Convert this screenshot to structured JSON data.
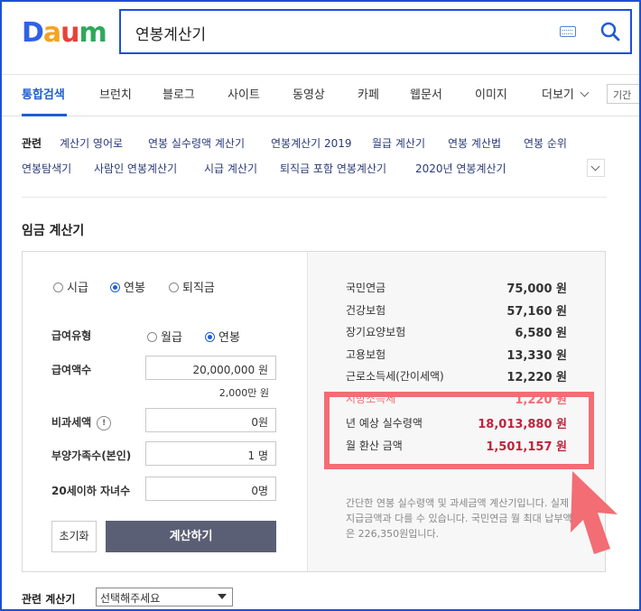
{
  "logo": {
    "text": "Daum",
    "letters": [
      "D",
      "a",
      "u",
      "m"
    ]
  },
  "search": {
    "query": "연봉계산기"
  },
  "tabs": [
    {
      "label": "통합검색",
      "active": true
    },
    {
      "label": "브런치"
    },
    {
      "label": "블로그"
    },
    {
      "label": "사이트"
    },
    {
      "label": "동영상"
    },
    {
      "label": "카페"
    },
    {
      "label": "웹문서"
    },
    {
      "label": "이미지"
    },
    {
      "label": "더보기"
    }
  ],
  "period_button": "기간",
  "related": {
    "label": "관련",
    "items": [
      "계산기 영어로",
      "연봉 실수령액 계산기",
      "연봉계산기 2019",
      "월급 계산기",
      "연봉 계산법",
      "연봉 순위",
      "연봉탐색기",
      "사람인 연봉계산기",
      "시급 계산기",
      "퇴직금 포함 연봉계산기",
      "2020년 연봉계산기"
    ]
  },
  "section_title": "임금 계산기",
  "calculator": {
    "mode_options": [
      {
        "label": "시급",
        "selected": false
      },
      {
        "label": "연봉",
        "selected": true
      },
      {
        "label": "퇴직금",
        "selected": false
      }
    ],
    "pay_type": {
      "label": "급여유형",
      "options": [
        {
          "label": "월급",
          "selected": false
        },
        {
          "label": "연봉",
          "selected": true
        }
      ]
    },
    "salary": {
      "label": "급여액수",
      "value": "20,000,000 원",
      "note": "2,000만 원"
    },
    "non_taxable": {
      "label": "비과세액",
      "value": "0원",
      "info": "!"
    },
    "dependents": {
      "label": "부양가족수(본인)",
      "value": "1 명"
    },
    "children": {
      "label": "20세이하 자녀수",
      "value": "0명"
    },
    "reset_label": "초기화",
    "calc_label": "계산하기"
  },
  "results": {
    "items": [
      {
        "label": "국민연금",
        "value": "75,000 원"
      },
      {
        "label": "건강보험",
        "value": "57,160 원"
      },
      {
        "label": "장기요양보험",
        "value": "6,580 원"
      },
      {
        "label": "고용보험",
        "value": "13,330 원"
      },
      {
        "label": "근로소득세(간이세액)",
        "value": "12,220 원"
      },
      {
        "label": "지방소득세",
        "value": "1,220 원"
      }
    ],
    "annual": {
      "label": "년 예상 실수령액",
      "value": "18,013,880 원"
    },
    "monthly": {
      "label": "월 환산 금액",
      "value": "1,501,157 원"
    },
    "description": "간단한 연봉 실수령액 및 과세금액 계산기입니다. 실제 지급금액과 다를 수 있습니다. 국민연금 월 최대 납부액은 226,350원입니다."
  },
  "footer": {
    "label": "관련 계산기",
    "select_value": "선택해주세요"
  },
  "colors": {
    "accent": "#1e5dd6",
    "highlight": "#f26d74",
    "result_red": "#c0243c",
    "button_dark": "#5b5f75"
  }
}
